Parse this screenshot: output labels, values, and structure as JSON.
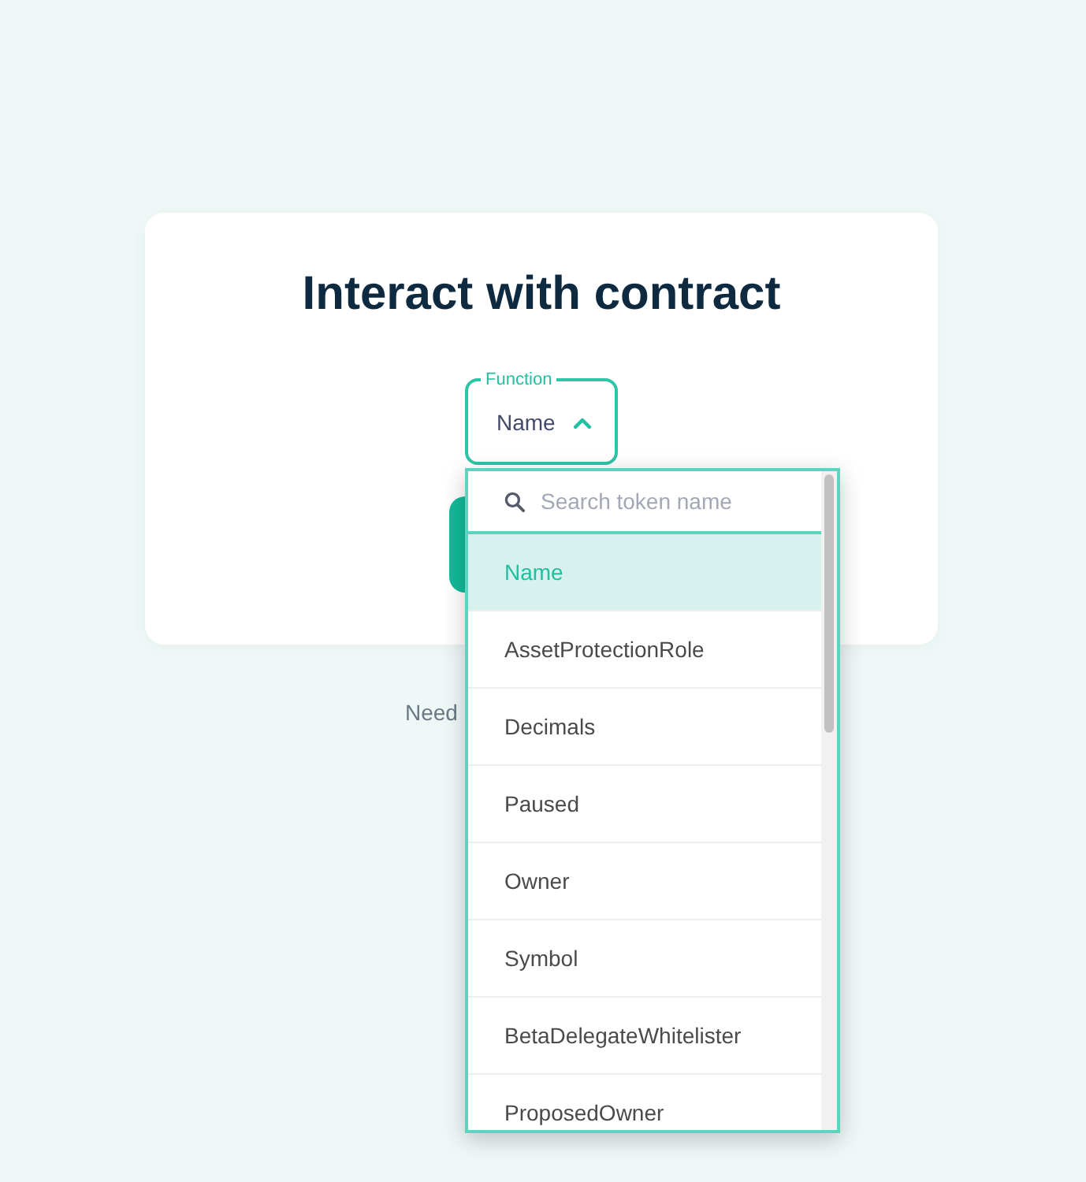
{
  "title": "Interact with contract",
  "function_select": {
    "label": "Function",
    "value": "Name",
    "expanded": true
  },
  "help_text": "Need",
  "dropdown": {
    "search": {
      "placeholder": "Search token name"
    },
    "options": [
      {
        "label": "Name",
        "selected": true
      },
      {
        "label": "AssetProtectionRole",
        "selected": false
      },
      {
        "label": "Decimals",
        "selected": false
      },
      {
        "label": "Paused",
        "selected": false
      },
      {
        "label": "Owner",
        "selected": false
      },
      {
        "label": "Symbol",
        "selected": false
      },
      {
        "label": "BetaDelegateWhitelister",
        "selected": false
      },
      {
        "label": "ProposedOwner",
        "selected": false
      }
    ]
  }
}
